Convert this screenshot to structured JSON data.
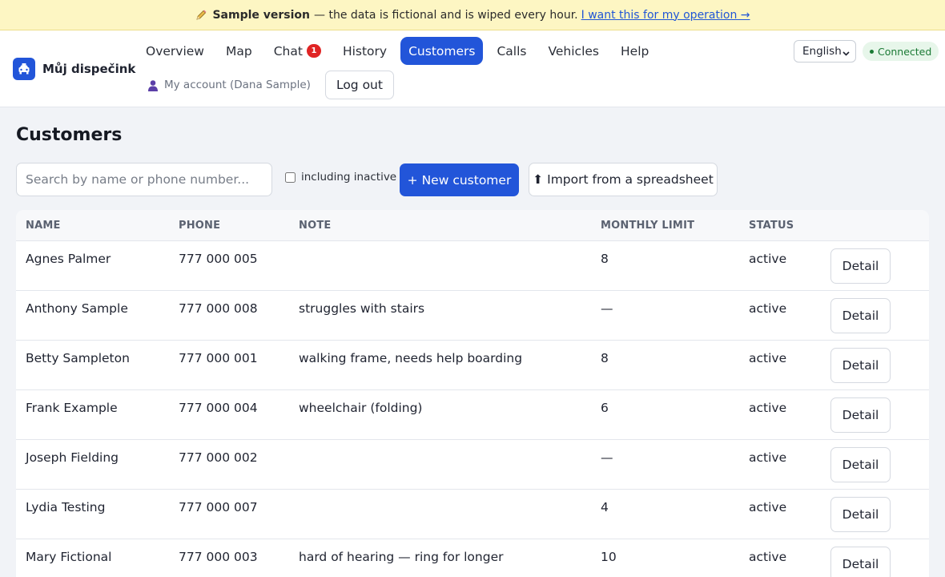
{
  "banner": {
    "icon": "pencil-icon",
    "bold": "Sample version",
    "text": "— the data is fictional and is wiped every hour.",
    "link": "I want this for my operation →"
  },
  "app": {
    "name": "Můj dispečink",
    "logo_icon": "taxi-icon",
    "brand_color": "#2255d9"
  },
  "nav": {
    "items": [
      {
        "label": "Overview"
      },
      {
        "label": "Map"
      },
      {
        "label": "Chat",
        "badge": "1"
      },
      {
        "label": "History"
      },
      {
        "label": "Customers",
        "active": true
      },
      {
        "label": "Calls"
      },
      {
        "label": "Vehicles"
      },
      {
        "label": "Help"
      }
    ]
  },
  "account": {
    "label": "My account (Dana Sample)",
    "icon": "person-icon",
    "logout": "Log out"
  },
  "language": {
    "selected": "English"
  },
  "connection": {
    "label": "Connected",
    "color": "#1b7a35"
  },
  "page": {
    "title": "Customers",
    "search_placeholder": "Search by name or phone number...",
    "inactive_label": "including inactive",
    "inactive_checked": false,
    "new_button": "+ New customer",
    "import_button": "⬆ Import from a spreadsheet"
  },
  "table": {
    "headers": {
      "name": "NAME",
      "phone": "PHONE",
      "note": "NOTE",
      "limit": "MONTHLY LIMIT",
      "status": "STATUS"
    },
    "detail_label": "Detail",
    "rows": [
      {
        "name": "Agnes Palmer",
        "phone": "777 000 005",
        "note": "",
        "limit": "8",
        "status": "active"
      },
      {
        "name": "Anthony Sample",
        "phone": "777 000 008",
        "note": "struggles with stairs",
        "limit": "—",
        "status": "active"
      },
      {
        "name": "Betty Sampleton",
        "phone": "777 000 001",
        "note": "walking frame, needs help boarding",
        "limit": "8",
        "status": "active"
      },
      {
        "name": "Frank Example",
        "phone": "777 000 004",
        "note": "wheelchair (folding)",
        "limit": "6",
        "status": "active"
      },
      {
        "name": "Joseph Fielding",
        "phone": "777 000 002",
        "note": "",
        "limit": "—",
        "status": "active"
      },
      {
        "name": "Lydia Testing",
        "phone": "777 000 007",
        "note": "",
        "limit": "4",
        "status": "active"
      },
      {
        "name": "Mary Fictional",
        "phone": "777 000 003",
        "note": "hard of hearing — ring for longer",
        "limit": "10",
        "status": "active"
      }
    ]
  }
}
